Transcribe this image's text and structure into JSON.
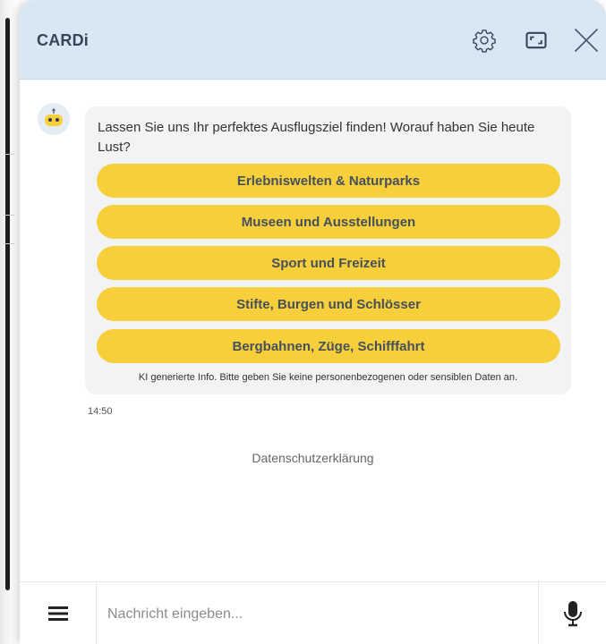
{
  "header": {
    "title": "CARDi",
    "icons": [
      "gear-icon",
      "expand-icon",
      "close-icon"
    ]
  },
  "chat": {
    "bot_avatar": "robot-icon",
    "message": "Lassen Sie uns Ihr perfektes Ausflugsziel finden! Worauf haben Sie heute Lust?",
    "options": [
      "Erlebniswelten & Naturparks",
      "Museen und Ausstellungen",
      "Sport und Freizeit",
      "Stifte, Burgen und Schlösser",
      "Bergbahnen, Züge, Schifffahrt"
    ],
    "disclaimer": "KI generierte Info. Bitte geben Sie keine personenbezogenen oder sensiblen Daten an.",
    "timestamp": "14:50"
  },
  "privacy_link": "Datenschutzerklärung",
  "input": {
    "placeholder": "Nachricht eingeben...",
    "value": ""
  },
  "colors": {
    "header_bg": "#d9e6f4",
    "accent_yellow": "#f7cf3b",
    "bubble_bg": "#f1f3f5",
    "title_color": "#36465a"
  }
}
